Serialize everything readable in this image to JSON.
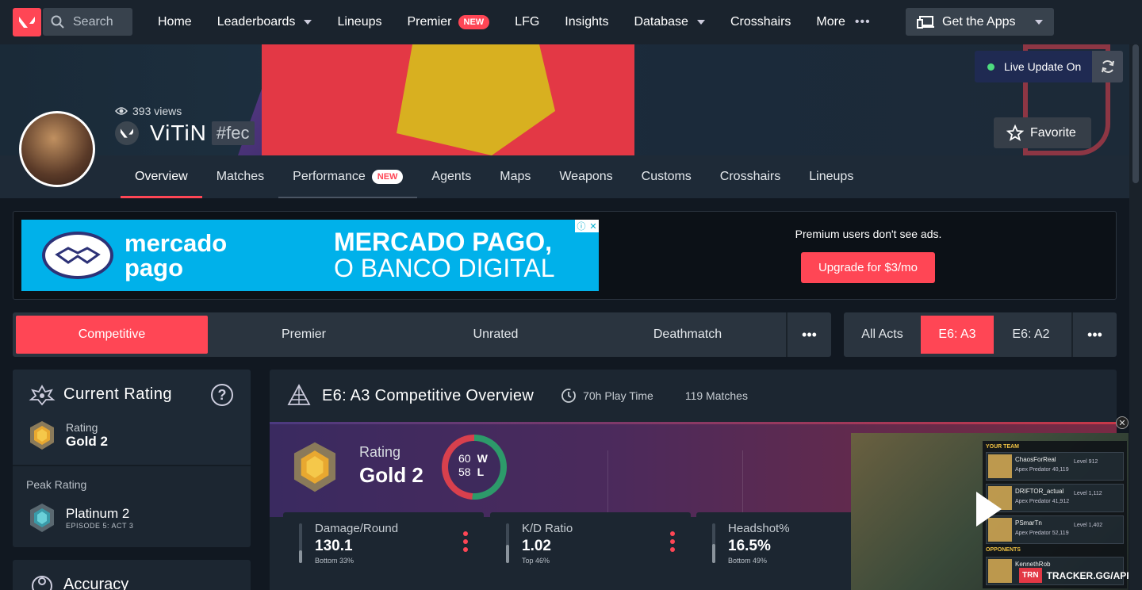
{
  "topnav": {
    "search_placeholder": "Search",
    "items": [
      {
        "label": "Home"
      },
      {
        "label": "Leaderboards",
        "dropdown": true
      },
      {
        "label": "Lineups"
      },
      {
        "label": "Premier",
        "badge": "NEW"
      },
      {
        "label": "LFG"
      },
      {
        "label": "Insights"
      },
      {
        "label": "Database",
        "dropdown": true
      },
      {
        "label": "Crosshairs"
      },
      {
        "label": "More"
      }
    ],
    "get_apps": "Get the Apps"
  },
  "hero": {
    "live_update": "Live Update On",
    "favorite": "Favorite"
  },
  "profile": {
    "views": "393 views",
    "name": "ViTiN",
    "tag": "#fec"
  },
  "subnav": {
    "items": [
      "Overview",
      "Matches",
      "Performance",
      "Agents",
      "Maps",
      "Weapons",
      "Customs",
      "Crosshairs",
      "Lineups"
    ],
    "new_badge": "NEW"
  },
  "ad": {
    "brand": "mercado pago",
    "line1": "MERCADO PAGO,",
    "line2": "O BANCO DIGITAL",
    "premium_text": "Premium users don't see ads.",
    "upgrade": "Upgrade for $3/mo"
  },
  "modes": [
    "Competitive",
    "Premier",
    "Unrated",
    "Deathmatch"
  ],
  "acts": [
    "All Acts",
    "E6: A3",
    "E6: A2"
  ],
  "current_rating": {
    "title": "Current Rating",
    "rating_label": "Rating",
    "rating_value": "Gold 2",
    "peak_label": "Peak Rating",
    "peak_value": "Platinum 2",
    "peak_episode": "EPISODE 5: ACT 3"
  },
  "accuracy": {
    "title": "Accuracy"
  },
  "overview": {
    "title": "E6: A3 Competitive Overview",
    "play_time": "70h Play Time",
    "matches": "119 Matches",
    "rating_label": "Rating",
    "rating_value": "Gold 2",
    "wins": "60",
    "wins_label": "W",
    "losses": "58",
    "losses_label": "L",
    "stats": [
      {
        "label": "Damage/Round",
        "value": "130.1",
        "sub": "Bottom 33%",
        "fill": 0.33
      },
      {
        "label": "K/D Ratio",
        "value": "1.02",
        "sub": "Top 46%",
        "fill": 0.46
      },
      {
        "label": "Headshot%",
        "value": "16.5%",
        "sub": "Bottom 49%",
        "fill": 0.49
      }
    ]
  },
  "video": {
    "team_label": "YOUR TEAM",
    "opponents_label": "OPPONENTS",
    "players": [
      {
        "name": "ChaosForReal",
        "sub": "Apex Predator 40,119",
        "level": "Level 912"
      },
      {
        "name": "DRIFTOR_actual",
        "sub": "Apex Predator 41,912",
        "level": "Level 1,112"
      },
      {
        "name": "PSmarTn",
        "sub": "Apex Predator 52,119",
        "level": "Level 1,402"
      },
      {
        "name": "KennethRob",
        "sub": "",
        "level": ""
      }
    ],
    "brand": "TRN",
    "url": "TRACKER.GG/APPS"
  },
  "colors": {
    "accent": "#ff4655",
    "nav_bg": "#1a232d",
    "page_bg": "#111821"
  }
}
